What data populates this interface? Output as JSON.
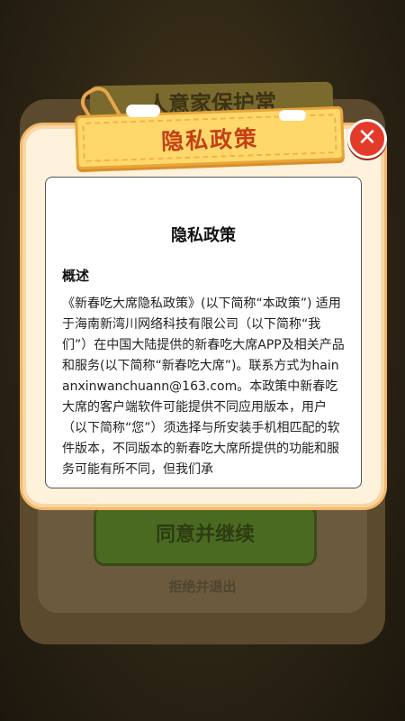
{
  "background": {
    "ribbon_title": "人意家保护常",
    "primary_button": "同意并继续",
    "secondary_link": "拒绝并退出"
  },
  "modal": {
    "header_title": "隐私政策",
    "close_icon": "close-icon",
    "content": {
      "doc_title": "隐私政策",
      "section_heading": "概述",
      "paragraph": "《新春吃大席隐私政策》(以下简称“本政策”) 适用于海南新湾川网络科技有限公司（以下简称“我们”）在中国大陆提供的新春吃大席APP及相关产品和服务(以下简称“新春吃大席”)。联系方式为hainanxinwanchuann@163.com。本政策中新春吃大席的客户端软件可能提供不同应用版本，用户（以下简称“您”）须选择与所安装手机相匹配的软件版本，不同版本的新春吃大席所提供的功能和服务可能有所不同，但我们承"
    }
  },
  "colors": {
    "title_red": "#c44015",
    "ribbon_yellow": "#ffd86b",
    "close_red": "#e43a2a",
    "modal_cream": "#fff2dc"
  }
}
